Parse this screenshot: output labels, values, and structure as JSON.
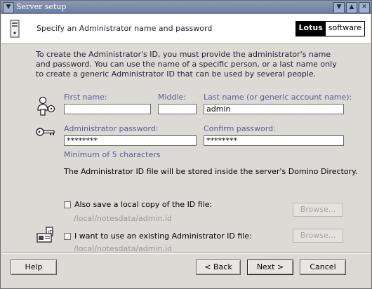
{
  "window": {
    "title": "Server setup"
  },
  "header": {
    "title": "Specify an Administrator name and password",
    "brand_strong": "Lotus",
    "brand_light": "software"
  },
  "intro": "To create the Administrator's ID, you must provide the administrator's name and password. You can use the name of a specific person, or a last name only to create a generic Administrator ID that can be used by several people.",
  "name": {
    "first_label": "First name:",
    "first_value": "",
    "middle_label": "Middle:",
    "middle_value": "",
    "last_label": "Last name (or generic account name):",
    "last_value": "admin"
  },
  "password": {
    "admin_label": "Administrator password:",
    "admin_value": "********",
    "confirm_label": "Confirm password:",
    "confirm_value": "********",
    "hint": "Minimum of 5 characters"
  },
  "store_note": "The Administrator ID file will be stored inside the server's Domino Directory.",
  "local_copy": {
    "label": "Also save a local copy of the ID file:",
    "path": "/local/notesdata/admin.id",
    "browse": "Browse...",
    "checked": false
  },
  "existing_id": {
    "label": "I want to use an existing Administrator ID file:",
    "path": "/local/notesdata/admin.id",
    "browse": "Browse...",
    "checked": false
  },
  "buttons": {
    "help": "Help",
    "back": "< Back",
    "next": "Next >",
    "cancel": "Cancel"
  }
}
